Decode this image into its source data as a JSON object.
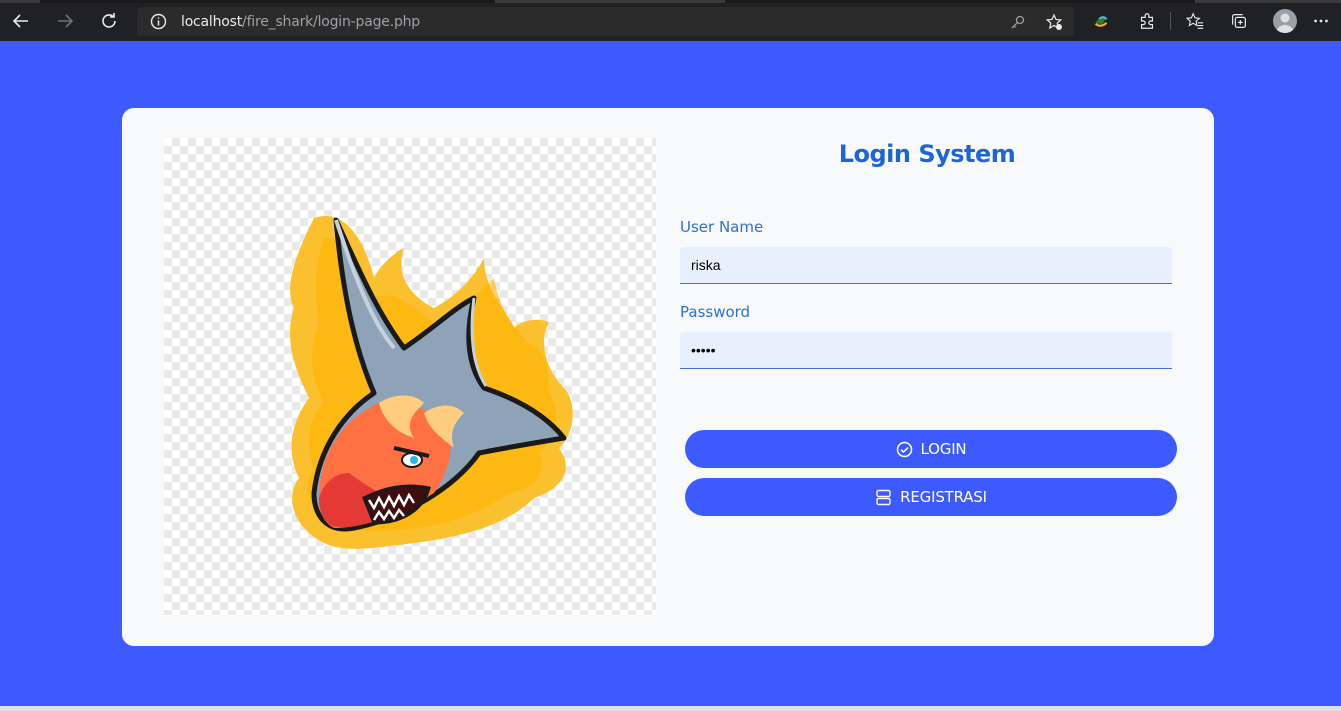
{
  "browser": {
    "url_host": "localhost",
    "url_path": "/fire_shark/login-page.php",
    "icons": [
      "back-icon",
      "forward-icon",
      "reload-icon",
      "info-icon",
      "key-icon",
      "add-favorite-icon",
      "extension-icon",
      "puzzle-icon",
      "favorites-icon",
      "collections-icon",
      "profile-icon",
      "more-icon"
    ]
  },
  "colors": {
    "page_background": "#3d5afe",
    "card_background": "#f8f9fa",
    "title": "#1e66d6",
    "button": "#3d5afe",
    "input_background": "#e8f0fe"
  },
  "login": {
    "title": "Login System",
    "username_label": "User Name",
    "username_value": "riska",
    "password_label": "Password",
    "password_value": "•••••",
    "login_button": "LOGIN",
    "register_button": "REGISTRASI",
    "login_icon": "check-circle-icon",
    "register_icon": "server-icon"
  }
}
